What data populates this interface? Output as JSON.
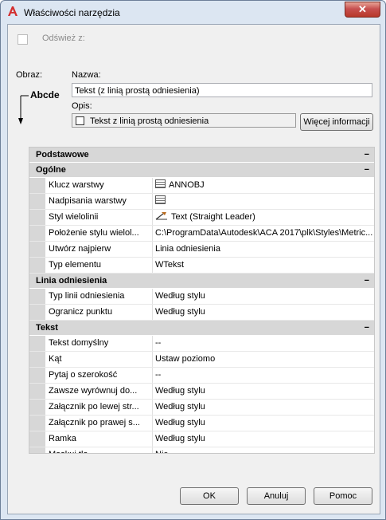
{
  "window": {
    "title": "Właściwości narzędzia",
    "close_label": "✕"
  },
  "refresh": {
    "label": "Odśwież z:"
  },
  "image": {
    "label": "Obraz:",
    "preview_text": "Abcde"
  },
  "name": {
    "label": "Nazwa:",
    "value": "Tekst (z linią prostą odniesienia)"
  },
  "description": {
    "label": "Opis:",
    "value": "Tekst z linią prostą odniesienia",
    "more_button": "Więcej informacji"
  },
  "properties": {
    "categories": [
      {
        "title": "Podstawowe",
        "rows": []
      },
      {
        "title": "Ogólne",
        "rows": [
          {
            "name": "Klucz warstwy",
            "value": "ANNOBJ",
            "icon": "table-icon"
          },
          {
            "name": "Nadpisania warstwy",
            "value": "",
            "icon": "table-icon"
          },
          {
            "name": "Styl wielolinii",
            "value": "Text (Straight Leader)",
            "icon": "leader-icon"
          },
          {
            "name": "Położenie stylu wielol...",
            "value": "C:\\ProgramData\\Autodesk\\ACA 2017\\plk\\Styles\\Metric..."
          },
          {
            "name": "Utwórz najpierw",
            "value": "Linia odniesienia"
          },
          {
            "name": "Typ elementu",
            "value": "WTekst"
          }
        ]
      },
      {
        "title": "Linia odniesienia",
        "rows": [
          {
            "name": "Typ linii odniesienia",
            "value": "Według stylu"
          },
          {
            "name": "Ogranicz punktu",
            "value": "Według stylu"
          }
        ]
      },
      {
        "title": "Tekst",
        "rows": [
          {
            "name": "Tekst domyślny",
            "value": "--"
          },
          {
            "name": "Kąt",
            "value": "Ustaw poziomo"
          },
          {
            "name": "Pytaj o szerokość",
            "value": "--"
          },
          {
            "name": "Zawsze wyrównuj do...",
            "value": "Według stylu"
          },
          {
            "name": "Załącznik po lewej str...",
            "value": "Według stylu"
          },
          {
            "name": "Załącznik po prawej s...",
            "value": "Według stylu"
          },
          {
            "name": "Ramka",
            "value": "Według stylu"
          },
          {
            "name": "Maskuj tło",
            "value": "Nie"
          }
        ]
      }
    ],
    "collapse_symbol": "−"
  },
  "buttons": {
    "ok": "OK",
    "cancel": "Anuluj",
    "help": "Pomoc"
  },
  "colors": {
    "title_bar": "#dce6f2",
    "category_bg": "#d7d7d7",
    "close_button": "#c75050",
    "app_icon_red": "#d32f2f"
  }
}
